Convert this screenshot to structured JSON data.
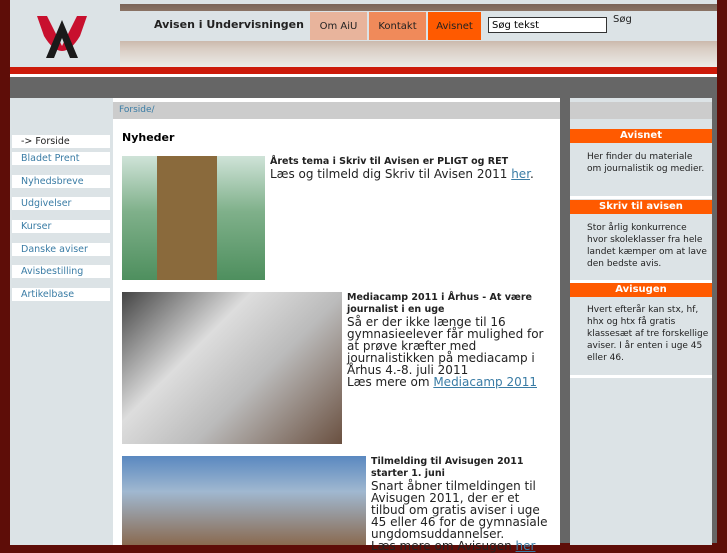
{
  "header": {
    "site_name": "Avisen i Undervisningen",
    "search_placeholder": "Søg tekst",
    "search_button": "Søg",
    "nav": [
      {
        "label": "Om AiU",
        "color": "#e8b49c"
      },
      {
        "label": "Kontakt",
        "color": "#f08a5a"
      },
      {
        "label": "Avisnet",
        "color": "#ff5a00"
      }
    ]
  },
  "breadcrumb": "Forside/",
  "sidebar": {
    "items": [
      "-> Forside",
      "Bladet Prent",
      "Nyhedsbreve",
      "Udgivelser",
      "Kurser",
      "Danske aviser",
      "Avisbestilling",
      "Artikelbase"
    ]
  },
  "main": {
    "title": "Nyheder",
    "articles": [
      {
        "title": "Årets tema i Skriv til Avisen er PLIGT og RET",
        "body": "Læs og tilmeld dig Skriv til Avisen 2011 ",
        "link": "her",
        "tail": "."
      },
      {
        "title": "Mediacamp 2011 i Århus - At være journalist i en uge",
        "body": "Så er der ikke længe til 16 gymnasieelever får mulighed for at prøve kræfter med journalistikken på mediacamp i Århus 4.-8. juli 2011",
        "more": "Læs mere om ",
        "link": "Mediacamp 2011"
      },
      {
        "title": "Tilmelding til Avisugen 2011 starter 1. juni",
        "body": "Snart åbner tilmeldingen til Avisugen 2011, der er et tilbud om gratis aviser i uge 45 eller 46 for de gymnasiale ungdomsuddannelser.",
        "more": "Læs mere om Avisugen ",
        "link": "her"
      }
    ]
  },
  "right": {
    "boxes": [
      {
        "title": "Avisnet",
        "text": "Her finder du materiale om journalistik og medier."
      },
      {
        "title": "Skriv til avisen",
        "text": "Stor årlig konkurrence hvor skoleklasser fra hele landet kæmper om at lave den bedste avis."
      },
      {
        "title": "Avisugen",
        "text": "Hvert efterår kan stx, hf, hhx og htx få gratis klassesæt af tre forskellige aviser. I år enten i uge 45 eller 46."
      }
    ]
  }
}
